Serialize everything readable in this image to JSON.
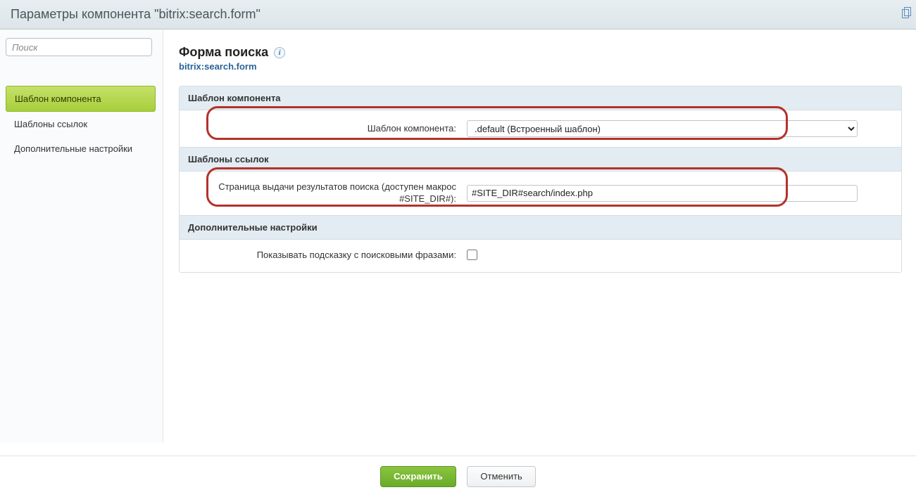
{
  "header": {
    "title": "Параметры компонента \"bitrix:search.form\""
  },
  "sidebar": {
    "search_placeholder": "Поиск",
    "items": [
      {
        "label": "Шаблон компонента",
        "active": true
      },
      {
        "label": "Шаблоны ссылок",
        "active": false
      },
      {
        "label": "Дополнительные настройки",
        "active": false
      }
    ]
  },
  "main": {
    "title": "Форма поиска",
    "code": "bitrix:search.form",
    "info_glyph": "i",
    "sections": [
      {
        "title": "Шаблон компонента",
        "fields": [
          {
            "label": "Шаблон компонента:",
            "type": "select",
            "value": ".default (Встроенный шаблон)"
          }
        ]
      },
      {
        "title": "Шаблоны ссылок",
        "fields": [
          {
            "label": "Страница выдачи результатов поиска (доступен макрос #SITE_DIR#):",
            "type": "text",
            "value": "#SITE_DIR#search/index.php"
          }
        ]
      },
      {
        "title": "Дополнительные настройки",
        "fields": [
          {
            "label": "Показывать подсказку с поисковыми фразами:",
            "type": "checkbox",
            "checked": false
          }
        ]
      }
    ]
  },
  "footer": {
    "save": "Сохранить",
    "cancel": "Отменить"
  }
}
